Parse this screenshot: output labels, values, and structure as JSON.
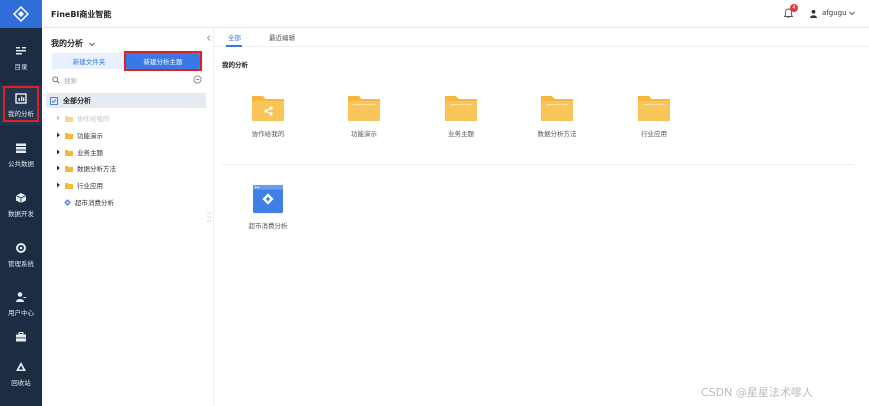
{
  "app": {
    "brand": "FineBI商业智能"
  },
  "header": {
    "notification_count": "4",
    "username": "afgugu"
  },
  "nav": [
    {
      "label": "目录",
      "icon": "catalog-icon"
    },
    {
      "label": "我的分析",
      "icon": "my-analysis-icon",
      "active": true
    },
    {
      "label": "公共数据",
      "icon": "public-data-icon"
    },
    {
      "label": "数据开发",
      "icon": "data-dev-icon"
    },
    {
      "label": "管理系统",
      "icon": "admin-icon"
    },
    {
      "label": "用户中心",
      "icon": "user-center-icon"
    },
    {
      "label": "",
      "icon": "briefcase-icon"
    },
    {
      "label": "回收站",
      "icon": "recycle-icon"
    }
  ],
  "panel": {
    "title": "我的分析",
    "new_folder": "新建文件夹",
    "new_theme": "新建分析主题",
    "search_placeholder": "搜索",
    "root": "全部分析",
    "items": [
      {
        "label": "协作给我的",
        "type": "folder",
        "muted": true
      },
      {
        "label": "功能演示",
        "type": "folder"
      },
      {
        "label": "业务主题",
        "type": "folder"
      },
      {
        "label": "数据分析方法",
        "type": "folder"
      },
      {
        "label": "行业应用",
        "type": "folder"
      },
      {
        "label": "超市消费分析",
        "type": "theme"
      }
    ]
  },
  "main": {
    "tabs": [
      {
        "label": "全部"
      },
      {
        "label": "最近编辑"
      }
    ],
    "section_title": "我的分析",
    "folders": [
      {
        "label": "协作给我的"
      },
      {
        "label": "功能演示"
      },
      {
        "label": "业务主题"
      },
      {
        "label": "数据分析方法"
      },
      {
        "label": "行业应用"
      }
    ],
    "themes": [
      {
        "label": "超市消费分析"
      }
    ]
  },
  "watermark": "CSDN @星星法术嗲人",
  "colors": {
    "rail": "#1c2c43",
    "accent": "#3a78e8",
    "folder": "#f5b83d",
    "highlight": "#e02020"
  }
}
